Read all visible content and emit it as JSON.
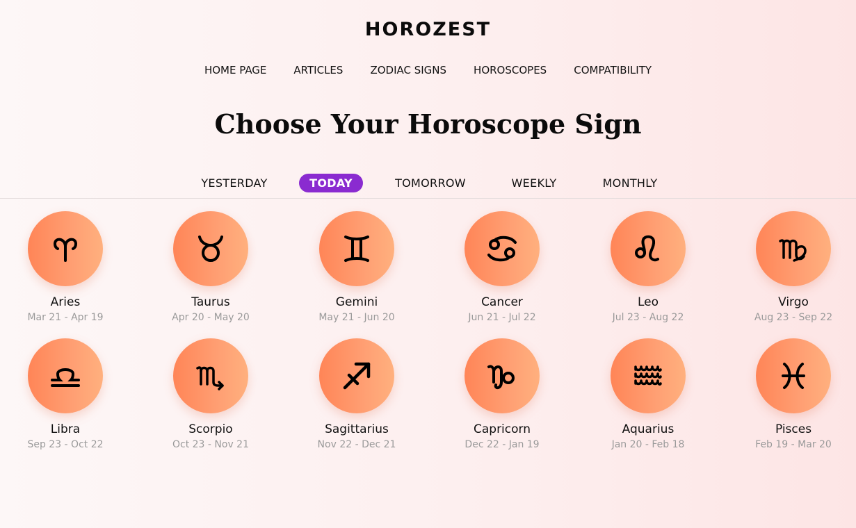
{
  "header": {
    "logo_text": "HOROZEST"
  },
  "nav": {
    "items": [
      "HOME PAGE",
      "ARTICLES",
      "ZODIAC SIGNS",
      "HOROSCOPES",
      "COMPATIBILITY"
    ]
  },
  "main": {
    "title": "Choose Your Horoscope Sign",
    "tabs": [
      {
        "label": "YESTERDAY",
        "active": false
      },
      {
        "label": "TODAY",
        "active": true
      },
      {
        "label": "TOMORROW",
        "active": false
      },
      {
        "label": "WEEKLY",
        "active": false
      },
      {
        "label": "MONTHLY",
        "active": false
      }
    ],
    "signs": [
      {
        "name": "Aries",
        "dates": "Mar 21 - Apr 19",
        "icon": "aries-icon"
      },
      {
        "name": "Taurus",
        "dates": "Apr 20 - May 20",
        "icon": "taurus-icon"
      },
      {
        "name": "Gemini",
        "dates": "May 21 - Jun 20",
        "icon": "gemini-icon"
      },
      {
        "name": "Cancer",
        "dates": "Jun 21 - Jul 22",
        "icon": "cancer-icon"
      },
      {
        "name": "Leo",
        "dates": "Jul 23 - Aug 22",
        "icon": "leo-icon"
      },
      {
        "name": "Virgo",
        "dates": "Aug 23 - Sep 22",
        "icon": "virgo-icon"
      },
      {
        "name": "Libra",
        "dates": "Sep 23 - Oct 22",
        "icon": "libra-icon"
      },
      {
        "name": "Scorpio",
        "dates": "Oct 23 - Nov 21",
        "icon": "scorpio-icon"
      },
      {
        "name": "Sagittarius",
        "dates": "Nov 22 - Dec 21",
        "icon": "sagittarius-icon"
      },
      {
        "name": "Capricorn",
        "dates": "Dec 22 - Jan 19",
        "icon": "capricorn-icon"
      },
      {
        "name": "Aquarius",
        "dates": "Jan 20 - Feb 18",
        "icon": "aquarius-icon"
      },
      {
        "name": "Pisces",
        "dates": "Feb 19 - Mar 20",
        "icon": "pisces-icon"
      }
    ]
  },
  "colors": {
    "accent": "#8a2bd0",
    "circle_start": "#ff8557",
    "circle_end": "#ffb07e"
  }
}
